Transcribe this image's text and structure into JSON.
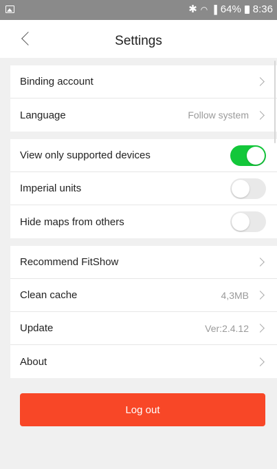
{
  "status_bar": {
    "icons": [
      "image-icon",
      "bluetooth-icon",
      "wifi-icon",
      "signal-icon",
      "battery-icon"
    ],
    "battery": "64%",
    "time": "8:36"
  },
  "header": {
    "title": "Settings"
  },
  "settings": {
    "binding_account": {
      "label": "Binding account"
    },
    "language": {
      "label": "Language",
      "value": "Follow system"
    },
    "view_only_supported": {
      "label": "View only supported devices",
      "state": "on"
    },
    "imperial_units": {
      "label": "Imperial units",
      "state": "off"
    },
    "hide_maps": {
      "label": "Hide maps from others",
      "state": "off"
    },
    "recommend": {
      "label": "Recommend FitShow"
    },
    "clean_cache": {
      "label": "Clean cache",
      "value": "4,3MB"
    },
    "update": {
      "label": "Update",
      "value": "Ver:2.4.12"
    },
    "about": {
      "label": "About"
    }
  },
  "logout": {
    "label": "Log out"
  },
  "colors": {
    "accent": "#f84727",
    "toggle_on": "#13c73a",
    "status_bar": "#8a8a8a"
  }
}
